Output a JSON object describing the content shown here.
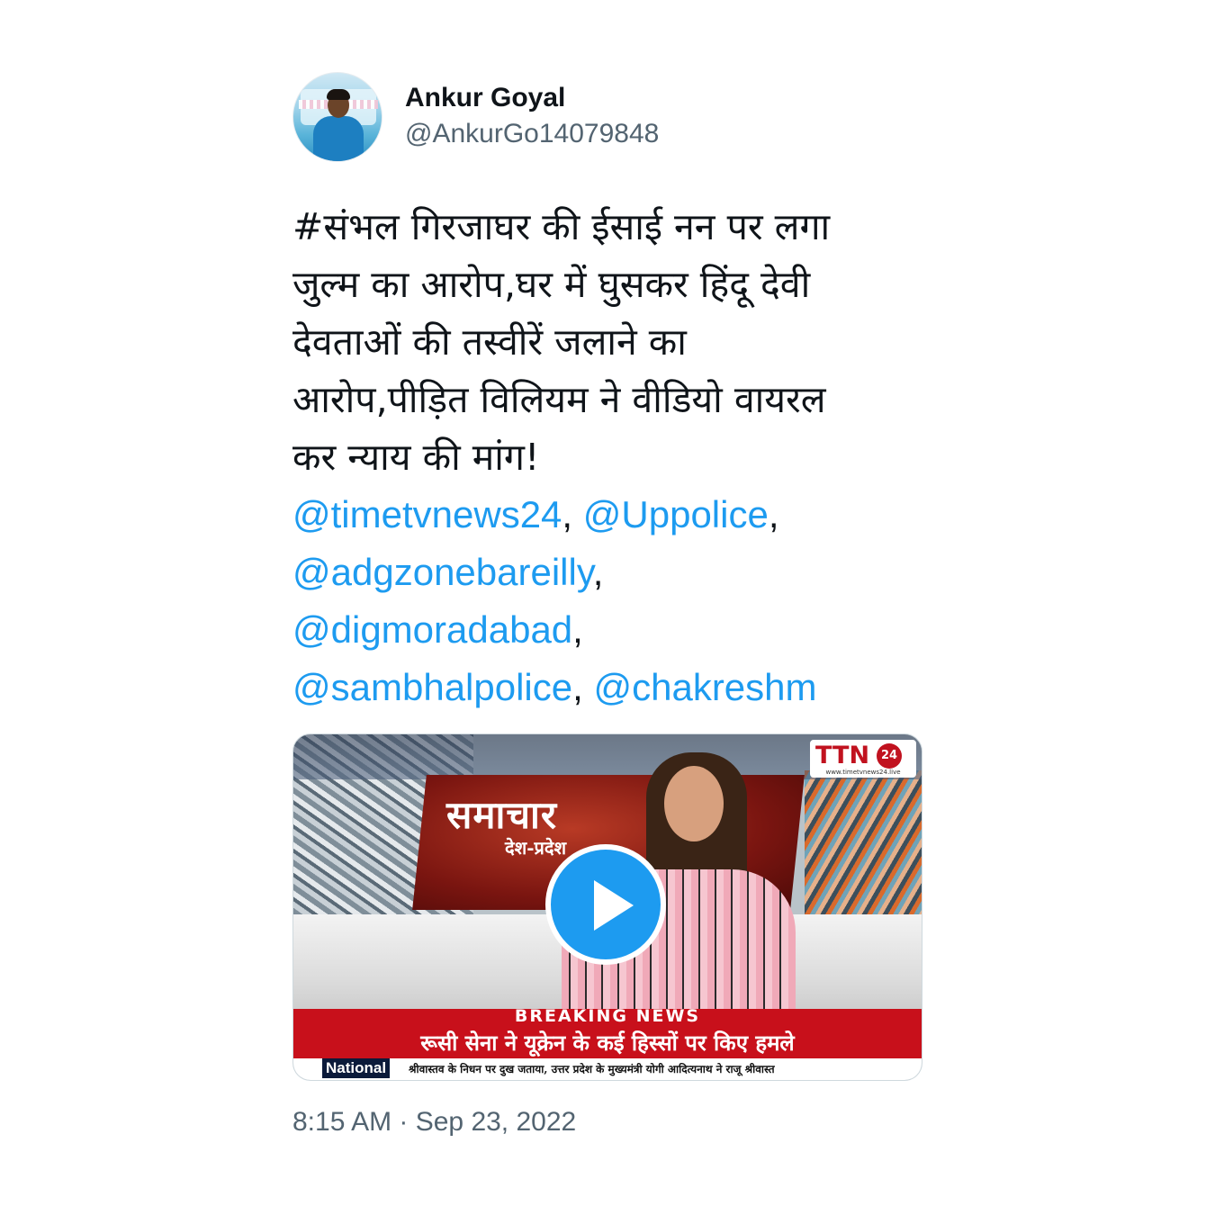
{
  "author": {
    "name": "Ankur Goyal",
    "handle": "@AnkurGo14079848"
  },
  "tweet": {
    "text_lines": [
      "#संभल गिरजाघर की ईसाई नन पर लगा",
      "जुल्म का आरोप,घर में घुसकर हिंदू देवी",
      "देवताओं की तस्वीरें जलाने का",
      "आरोप,पीड़ित विलियम ने वीडियो वायरल",
      "कर न्याय की मांग!"
    ],
    "mentions": [
      "@timetvnews24",
      "@Uppolice",
      "@adgzonebareilly",
      "@digmoradabad",
      "@sambhalpolice",
      "@chakreshm"
    ],
    "separator": ","
  },
  "video": {
    "studio_title": "समाचार",
    "studio_subtitle": "देश-प्रदेश",
    "logo_text": "TTN",
    "logo_badge": "24",
    "logo_url": "www.timetvnews24.live",
    "breaking_label": "BREAKING NEWS",
    "breaking_headline": "रूसी सेना ने यूक्रेन के कई हिस्सों पर किए हमले",
    "ticker_label": "National",
    "ticker_text": "श्रीवास्तव के निधन पर दुख जताया,       उत्तर प्रदेश के मुख्यमंत्री योगी आदित्यनाथ ने राजू श्रीवास्त"
  },
  "timestamp": "8:15 AM · Sep 23, 2022",
  "colors": {
    "link": "#1d9bf0",
    "secondary_text": "#536471",
    "breaking_red": "#c8101b"
  }
}
